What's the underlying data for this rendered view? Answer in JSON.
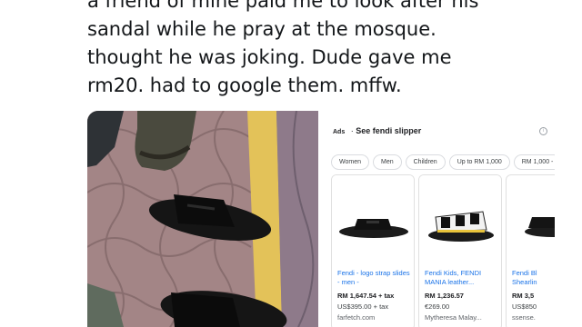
{
  "tweet": {
    "lines": [
      "a friend of mine paid me to look after his",
      "sandal while he pray at the mosque.",
      "thought he was joking. Dude gave me",
      "rm20. had to google them. mffw."
    ]
  },
  "ads": {
    "tag": "Ads",
    "title": "See fendi slipper",
    "info_icon": "info-icon",
    "filters": [
      "Women",
      "Men",
      "Children",
      "Up to RM 1,000",
      "RM 1,000 -"
    ],
    "products": [
      {
        "title": "Fendi - logo strap slides - men -",
        "price": "RM 1,647.54 + tax",
        "alt_price": "US$395.00 + tax",
        "store": "farfetch.com"
      },
      {
        "title": "Fendi Kids, FENDI MANIA leather...",
        "price": "RM 1,236.57",
        "alt_price": "€269.00",
        "store": "Mytheresa Malay..."
      },
      {
        "title": "Fendi Bl Shearlin",
        "price": "RM 3,5",
        "alt_price": "US$850",
        "store": "ssense."
      }
    ]
  }
}
